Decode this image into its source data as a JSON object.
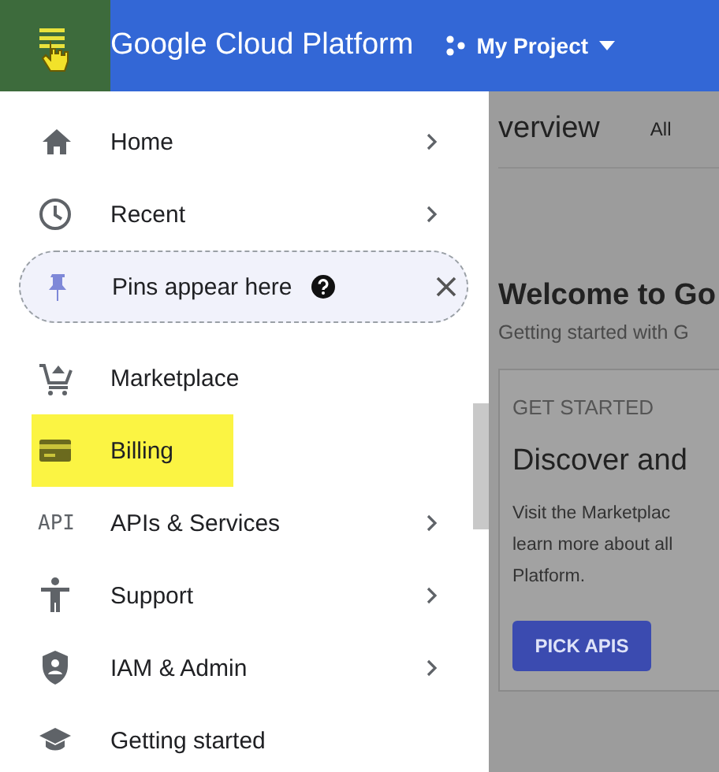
{
  "header": {
    "title": "Google Cloud Platform",
    "project": "My Project"
  },
  "nav": [
    {
      "kind": "nav",
      "label": "Home",
      "has_submenu": true,
      "highlighted": false
    },
    {
      "kind": "nav",
      "label": "Recent",
      "has_submenu": true,
      "highlighted": false
    },
    {
      "kind": "pins",
      "label": "Pins appear here"
    },
    {
      "kind": "nav",
      "label": "Marketplace",
      "has_submenu": false,
      "highlighted": false
    },
    {
      "kind": "nav",
      "label": "Billing",
      "has_submenu": false,
      "highlighted": true
    },
    {
      "kind": "nav",
      "label": "APIs & Services",
      "icon_text": "API",
      "has_submenu": true,
      "highlighted": false
    },
    {
      "kind": "nav",
      "label": "Support",
      "has_submenu": true,
      "highlighted": false
    },
    {
      "kind": "nav",
      "label": "IAM & Admin",
      "has_submenu": true,
      "highlighted": false
    },
    {
      "kind": "nav",
      "label": "Getting started",
      "has_submenu": false,
      "highlighted": false
    }
  ],
  "content": {
    "page_title": "verview",
    "tab": "All",
    "welcome": "Welcome to Go",
    "welcome_sub": "Getting started with G",
    "card": {
      "eyebrow": "GET STARTED",
      "title": "Discover and",
      "body_lines": [
        "Visit the Marketplac",
        "learn more about all",
        "Platform."
      ],
      "button": "PICK APIS"
    }
  }
}
